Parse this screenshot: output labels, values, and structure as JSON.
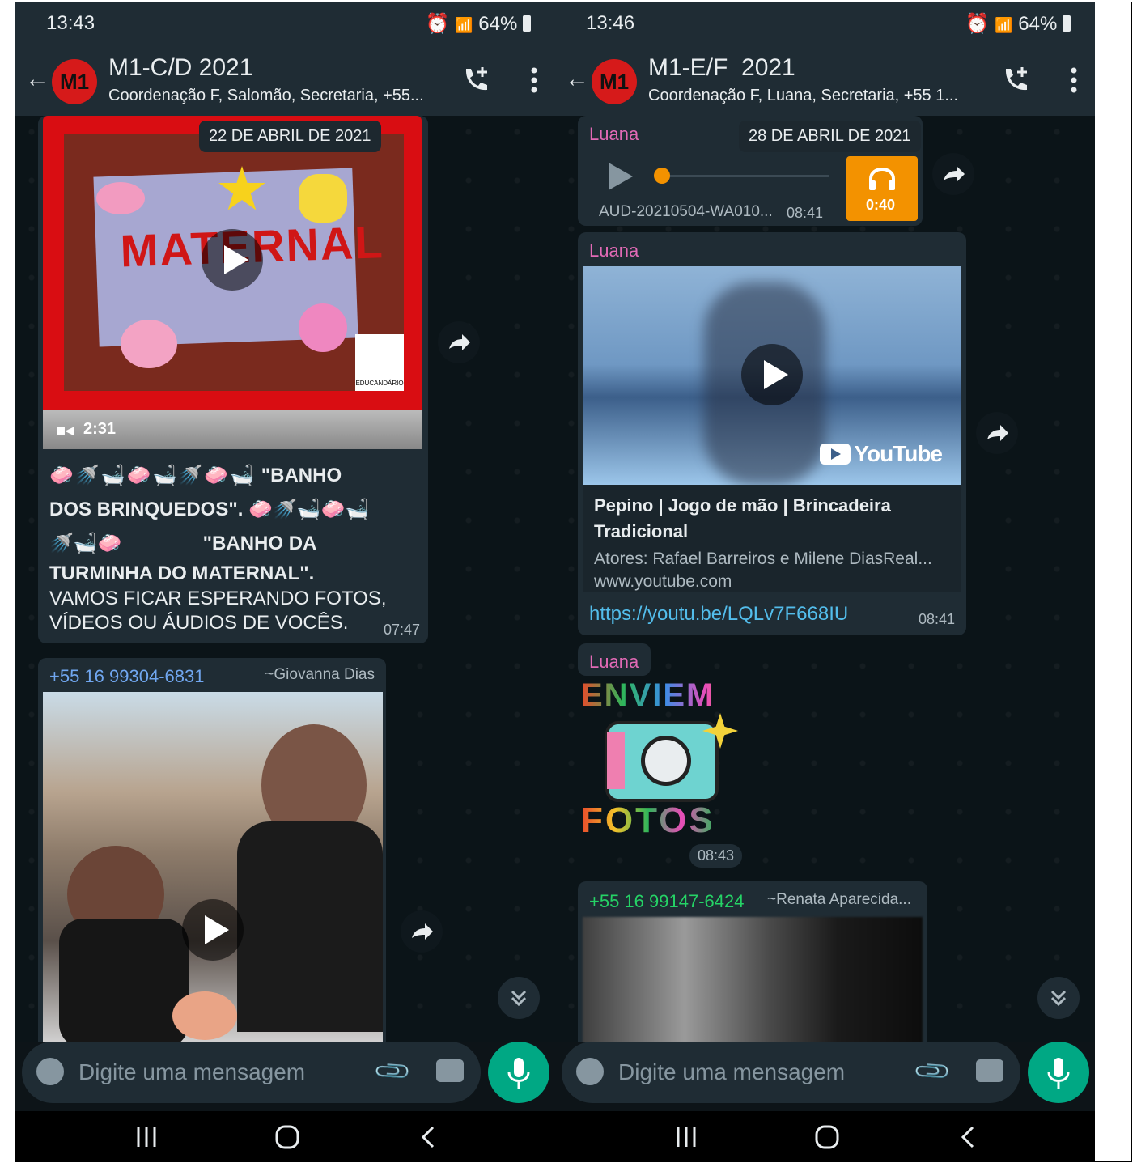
{
  "left": {
    "status": {
      "time": "13:43",
      "battery": "64%"
    },
    "header": {
      "group_name": "M1-C/D 2021",
      "subtitle": "Coordenação F, Salomão, Secretaria, +55...",
      "avatar": "M1"
    },
    "date_chip": "22 DE ABRIL DE 2021",
    "video1": {
      "banner_text": "MATERNAL",
      "logo": "EDUCANDÁRIO",
      "duration": "2:31"
    },
    "caption": {
      "line1": "\"BANHO",
      "line2": "DOS BRINQUEDOS\".",
      "line3": "\"BANHO DA",
      "line4": "TURMINHA DO MATERNAL\".",
      "line5": "VAMOS FICAR ESPERANDO FOTOS,",
      "line6": "VÍDEOS OU ÁUDIOS DE VOCÊS.",
      "time": "07:47"
    },
    "msg2": {
      "phone": "+55 16 99304-6831",
      "name": "~Giovanna Dias"
    },
    "input_placeholder": "Digite uma mensagem"
  },
  "right": {
    "status": {
      "time": "13:46",
      "battery": "64%"
    },
    "header": {
      "group_name": "M1-E/F  2021",
      "subtitle": "Coordenação F, Luana, Secretaria, +55 1...",
      "avatar": "M1"
    },
    "date_chip": "28 DE ABRIL DE 2021",
    "audio": {
      "sender": "Luana",
      "file": "AUD-20210504-WA010...",
      "time": "08:41",
      "duration": "0:40"
    },
    "youtube": {
      "sender": "Luana",
      "brand": "YouTube",
      "title_line1": "Pepino | Jogo de mão | Brincadeira",
      "title_line2": "Tradicional",
      "desc": "Atores: Rafael Barreiros e Milene DiasReal...",
      "domain": "www.youtube.com",
      "link": "https://youtu.be/LQLv7F668IU",
      "time": "08:41"
    },
    "sticker": {
      "sender": "Luana",
      "top_text": "ENVIEM",
      "bottom_text": "FOTOS",
      "time": "08:43"
    },
    "msg4": {
      "phone": "+55 16 99147-6424",
      "name": "~Renata Aparecida..."
    },
    "input_placeholder": "Digite uma mensagem"
  },
  "colors": {
    "accent": "#00a884",
    "bubble": "#1f2c34",
    "bar": "#1f2c34",
    "link": "#53bdeb",
    "sender_pink": "#e26ab6",
    "sender_blue": "#71a7f0",
    "sender_green": "#25d366",
    "audio_orange": "#f39200"
  }
}
